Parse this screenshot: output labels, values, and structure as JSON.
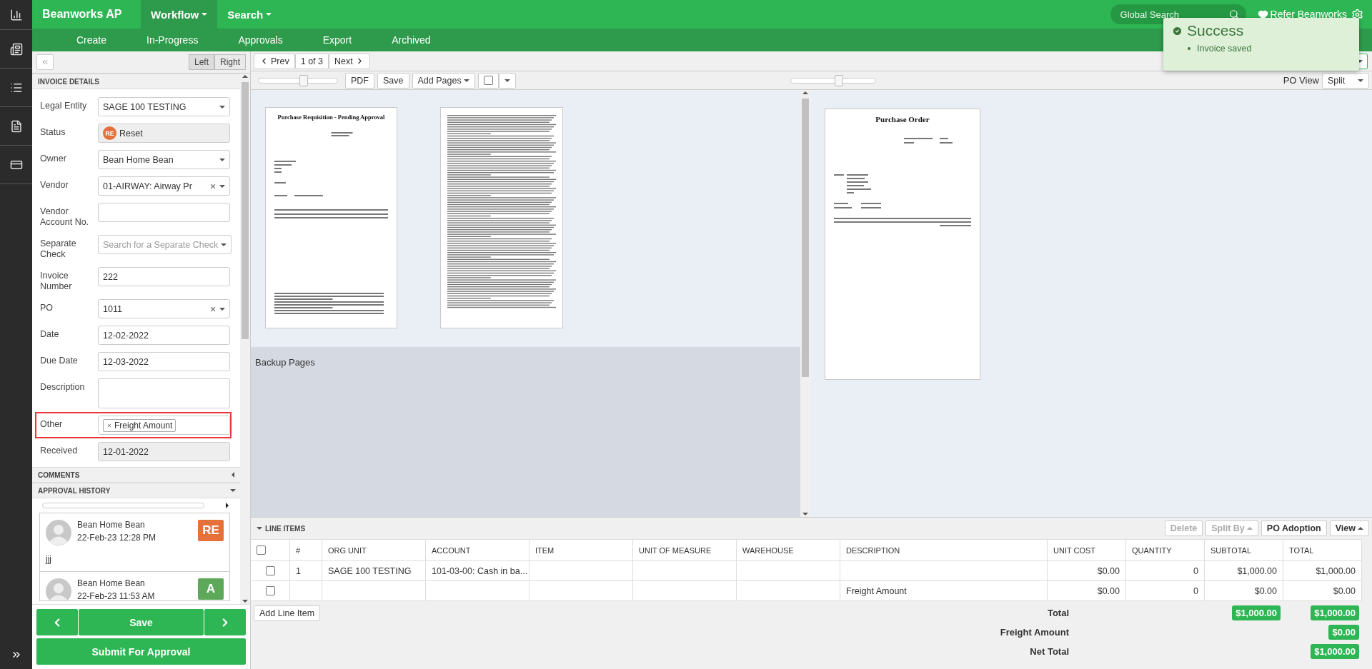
{
  "brand": "Beanworks AP",
  "top_menu": [
    {
      "label": "Workflow",
      "selected": true
    },
    {
      "label": "Search",
      "selected": false
    }
  ],
  "global_search": {
    "placeholder": "Global Search"
  },
  "refer_link": "Refer Beanworks",
  "sub_menu": [
    "Create",
    "In-Progress",
    "Approvals",
    "Export",
    "Archived"
  ],
  "panel_toggle": [
    {
      "label": "Left",
      "selected": true
    },
    {
      "label": "Right",
      "selected": false
    }
  ],
  "invoice_details": {
    "title": "INVOICE DETAILS",
    "fields": [
      {
        "label": "Legal Entity",
        "kind": "select",
        "value": "SAGE 100 TESTING",
        "clearable": false,
        "highlighted": false
      },
      {
        "label": "Status",
        "kind": "status",
        "badge": "RE",
        "value": "Reset",
        "highlighted": false
      },
      {
        "label": "Owner",
        "kind": "select",
        "value": "Bean Home Bean",
        "clearable": false,
        "highlighted": false
      },
      {
        "label": "Vendor",
        "kind": "select",
        "value": "01-AIRWAY: Airway Pr",
        "clearable": true,
        "highlighted": false
      },
      {
        "label": "Vendor Account No.",
        "kind": "text",
        "highlighted": false
      },
      {
        "label": "Separate Check",
        "kind": "select",
        "placeholder": "Search for a Separate Check",
        "clearable": false,
        "highlighted": false
      },
      {
        "label": "Invoice Number",
        "kind": "text",
        "value": "222",
        "highlighted": false
      },
      {
        "label": "PO",
        "kind": "select",
        "value": "1011",
        "clearable": true,
        "highlighted": false
      },
      {
        "label": "Date",
        "kind": "text",
        "value": "12-02-2022",
        "highlighted": false
      },
      {
        "label": "Due Date",
        "kind": "text",
        "value": "12-03-2022",
        "highlighted": false
      },
      {
        "label": "Description",
        "kind": "textarea",
        "highlighted": false
      },
      {
        "label": "Other",
        "kind": "tags",
        "tags": [
          "Freight Amount"
        ],
        "highlighted": true
      },
      {
        "label": "Received",
        "kind": "readonly",
        "value": "12-01-2022",
        "highlighted": false
      }
    ]
  },
  "comments": {
    "title": "COMMENTS",
    "expanded": false
  },
  "approval_history": {
    "title": "APPROVAL HISTORY",
    "expanded": true,
    "entries": [
      {
        "name": "Bean Home Bean",
        "time": "22-Feb-23 12:28 PM",
        "badge": "RE",
        "color": "#e5703a",
        "comment": "jjj"
      },
      {
        "name": "Bean Home Bean",
        "time": "22-Feb-23 11:53 AM",
        "badge": "A",
        "color": "#5ea85a"
      }
    ]
  },
  "footer": {
    "save": "Save",
    "submit": "Submit For Approval"
  },
  "pager": {
    "prev": "Prev",
    "position": "1 of 3",
    "next": "Next"
  },
  "doc_toolbar": {
    "zoom": {
      "level": 0.57
    },
    "buttons": [
      "PDF",
      "Save"
    ],
    "add_pages": "Add Pages",
    "select_page": {
      "checked": false
    }
  },
  "po_toolbar": {
    "zoom": {
      "level": 0.57
    },
    "view_label": "PO View",
    "view": "Split"
  },
  "invoice_pages": [
    {
      "kind": "cover",
      "title": "Purchase Requisition - Pending Approval"
    },
    {
      "kind": "terms"
    }
  ],
  "backup_pages": {
    "title": "Backup Pages"
  },
  "po_pages": [
    {
      "title": "Purchase Order"
    }
  ],
  "line_items": {
    "title": "LINE ITEMS",
    "expanded": true,
    "actions": [
      {
        "label": "Delete",
        "disabled": true,
        "dropdown": false
      },
      {
        "label": "Split By",
        "disabled": true,
        "dropdown": true
      },
      {
        "label": "PO Adoption",
        "disabled": false,
        "dropdown": false
      },
      {
        "label": "View",
        "disabled": false,
        "dropdown": true
      }
    ],
    "select_all": {
      "checked": false
    },
    "columns": [
      "#",
      "ORG UNIT",
      "ACCOUNT",
      "ITEM",
      "UNIT OF MEASURE",
      "WAREHOUSE",
      "DESCRIPTION",
      "UNIT COST",
      "QUANTITY",
      "SUBTOTAL",
      "TOTAL"
    ],
    "rows": [
      {
        "checked": false,
        "cells": [
          "1",
          "SAGE 100 TESTING",
          "101-03-00: Cash in ba...",
          "",
          "",
          "",
          "",
          "$0.00",
          "0",
          "$1,000.00",
          "$1,000.00"
        ]
      },
      {
        "checked": false,
        "cells": [
          "",
          "",
          "",
          "",
          "",
          "",
          "Freight Amount",
          "$0.00",
          "0",
          "$0.00",
          "$0.00"
        ]
      }
    ],
    "add_button": "Add Line Item",
    "totals": [
      {
        "label": "Total",
        "subtotal": "$1,000.00",
        "total": "$1,000.00"
      },
      {
        "label": "Freight Amount",
        "total": "$0.00"
      },
      {
        "label": "Net Total",
        "total": "$1,000.00"
      }
    ]
  },
  "toast": {
    "title": "Success",
    "messages": [
      "Invoice saved"
    ]
  }
}
